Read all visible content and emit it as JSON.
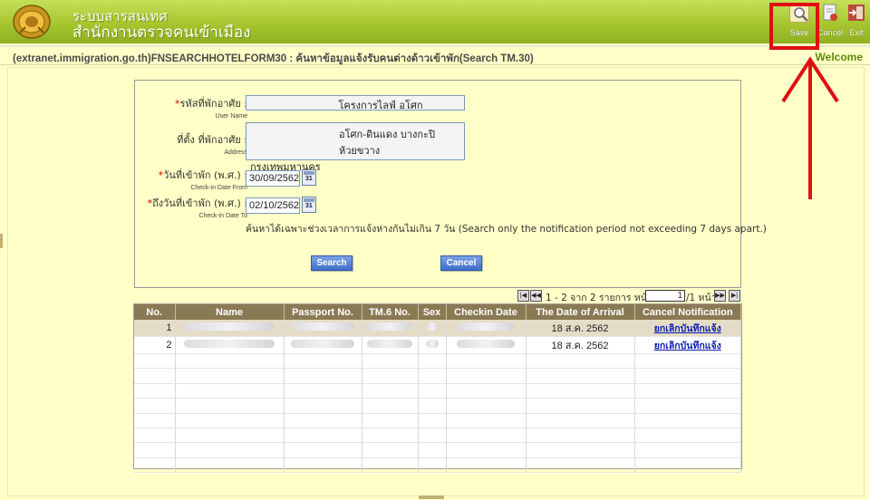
{
  "header": {
    "title_line1": "ระบบสารสนเทศ",
    "title_line2": "สำนักงานตรวจคนเข้าเมือง",
    "toolbar": {
      "save_label": "Save",
      "cancel_label": "Cancel",
      "exit_label": "Exit",
      "save_icon": "magnifier-icon",
      "cancel_icon": "cancel-document-icon",
      "exit_icon": "exit-door-icon"
    }
  },
  "pathbar": {
    "path": "(extranet.immigration.go.th)FNSEARCHHOTELFORM30 : ค้นหาข้อมูลแจ้งรับคนต่างด้าวเข้าพัก(Search TM.30)",
    "welcome": "Welcome"
  },
  "form": {
    "user_label_th": "รหัสที่พักอาศัย :",
    "user_label_en": "User Name",
    "user_value": "โครงการไลฟ์ อโศก",
    "address_label_th": "ที่ตั้ง ที่พักอาศัย :",
    "address_label_en": "Address",
    "address_line1": "อโศก-ดินแดง บางกะปิ ห้วยขวาง",
    "address_line2": "กรุงเทพมหานคร",
    "checkin_from_label_th": "วันที่เข้าพัก (พ.ศ.) :",
    "checkin_from_label_en": "Check-in Date From",
    "checkin_from_value": "30/09/2562",
    "checkin_to_label_th": "ถึงวันที่เข้าพัก (พ.ศ.) :",
    "checkin_to_label_en": "Check-in Date To",
    "checkin_to_value": "02/10/2562",
    "required_mark": "*",
    "calendar_text": "31",
    "note": "ค้นหาได้เฉพาะช่วงเวลาการแจ้งห่างกันไม่เกิน 7 วัน (Search only the notification period not exceeding 7 days apart.)",
    "search_button": "Search",
    "cancel_button": "Cancel"
  },
  "pager": {
    "info": "1 - 2 จาก 2 รายการ หน้า",
    "page_value": "1",
    "total": "/1 หน้า",
    "first": "|◀",
    "prev": "◀◀",
    "next": "▶▶",
    "last": "▶|"
  },
  "table": {
    "columns": [
      "No.",
      "Name",
      "Passport No.",
      "TM.6 No.",
      "Sex",
      "Checkin Date",
      "The Date of Arrival",
      "Cancel Notification"
    ],
    "rows": [
      {
        "no": "1",
        "arrival": "18 ส.ค. 2562",
        "cancel": "ยกเลิกบันทึกแจ้ง"
      },
      {
        "no": "2",
        "arrival": "18 ส.ค. 2562",
        "cancel": "ยกเลิกบันทึกแจ้ง"
      }
    ]
  },
  "colors": {
    "header_green": "#a6c630",
    "background": "#ffffc8",
    "table_header": "#8a7a54",
    "button_blue": "#3e6ec8",
    "annotation_red": "#e01010"
  }
}
